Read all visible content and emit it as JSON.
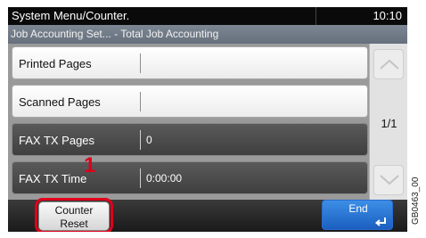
{
  "header": {
    "title": "System Menu/Counter.",
    "time": "10:10"
  },
  "breadcrumb": "Job Accounting Set... - Total Job Accounting",
  "rows": [
    {
      "label": "Printed Pages",
      "value": ""
    },
    {
      "label": "Scanned Pages",
      "value": ""
    },
    {
      "label": "FAX TX Pages",
      "value": "0"
    },
    {
      "label": "FAX TX Time",
      "value": "0:00:00"
    }
  ],
  "pagination": {
    "indicator": "1/1"
  },
  "footer": {
    "counter_reset_line1": "Counter",
    "counter_reset_line2": "Reset",
    "end_label": "End"
  },
  "callout": "1",
  "figure_code": "GB0463_00",
  "colors": {
    "highlight": "#e0001a",
    "end_button": "#2f7de0",
    "title_bar": "#0a0a0a"
  }
}
